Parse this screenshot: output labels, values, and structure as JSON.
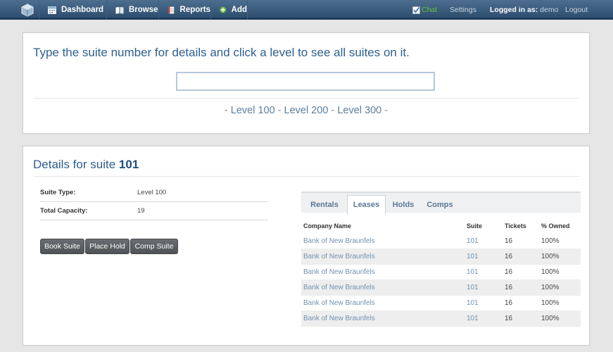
{
  "nav": {
    "items": [
      {
        "label": "Dashboard",
        "icon": "calendar-icon"
      },
      {
        "label": "Browse",
        "icon": "book-icon"
      },
      {
        "label": "Reports",
        "icon": "report-icon"
      },
      {
        "label": "Add",
        "icon": "plus-circle-icon"
      }
    ],
    "chat": "Chat",
    "settings": "Settings",
    "logged_in_label": "Logged in as:",
    "user": "demo",
    "logout": "Logout"
  },
  "search_panel": {
    "title": "Type the suite number for details and click a level to see all suites on it.",
    "input_value": "",
    "separator": "-",
    "levels": [
      "Level 100",
      "Level 200",
      "Level 300"
    ]
  },
  "details": {
    "title_prefix": "Details for suite",
    "suite_number": "101",
    "rows": [
      {
        "label": "Suite Type:",
        "value": "Level 100"
      },
      {
        "label": "Total Capacity:",
        "value": "19"
      }
    ],
    "buttons": [
      "Book Suite",
      "Place Hold",
      "Comp Suite"
    ]
  },
  "tabs": {
    "items": [
      "Rentals",
      "Leases",
      "Holds",
      "Comps"
    ],
    "active": "Leases",
    "columns": [
      "Company Name",
      "Suite",
      "Tickets",
      "% Owned"
    ],
    "rows": [
      [
        "Bank of New Braunfels",
        "101",
        "16",
        "100%"
      ],
      [
        "Bank of New Braunfels",
        "101",
        "16",
        "100%"
      ],
      [
        "Bank of New Braunfels",
        "101",
        "16",
        "100%"
      ],
      [
        "Bank of New Braunfels",
        "101",
        "16",
        "100%"
      ],
      [
        "Bank of New Braunfels",
        "101",
        "16",
        "100%"
      ],
      [
        "Bank of New Braunfels",
        "101",
        "16",
        "100%"
      ]
    ]
  }
}
